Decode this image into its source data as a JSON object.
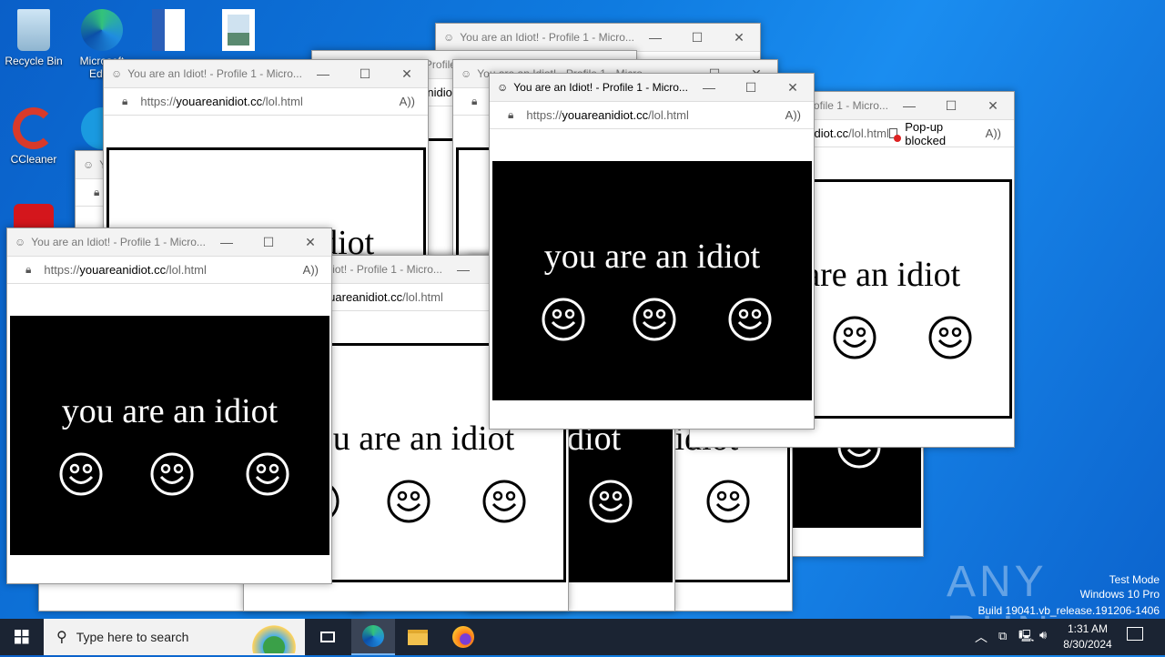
{
  "desktop_icons": [
    {
      "label": "Recycle Bin"
    },
    {
      "label": "Microsoft Edge"
    },
    {
      "label": "CCleaner"
    }
  ],
  "window": {
    "title": "You are an Idiot! - Profile 1 - Micro...",
    "url_scheme": "https://",
    "url_domain": "youareanidiot.cc",
    "url_path": "/lol.html",
    "page_text": "you are an idiot",
    "popup_blocked": "Pop-up blocked",
    "minimize": "—",
    "maximize": "☐",
    "close": "✕"
  },
  "taskbar": {
    "search_placeholder": "Type here to search",
    "time": "1:31 AM",
    "date": "8/30/2024"
  },
  "watermark": {
    "brand": "ANY RUN",
    "line1": "Test Mode",
    "line2": "Windows 10 Pro",
    "line3": "Build 19041.vb_release.191206-1406"
  },
  "colors": {
    "desktop": "#0f7be0",
    "taskbar": "#1b2433"
  }
}
